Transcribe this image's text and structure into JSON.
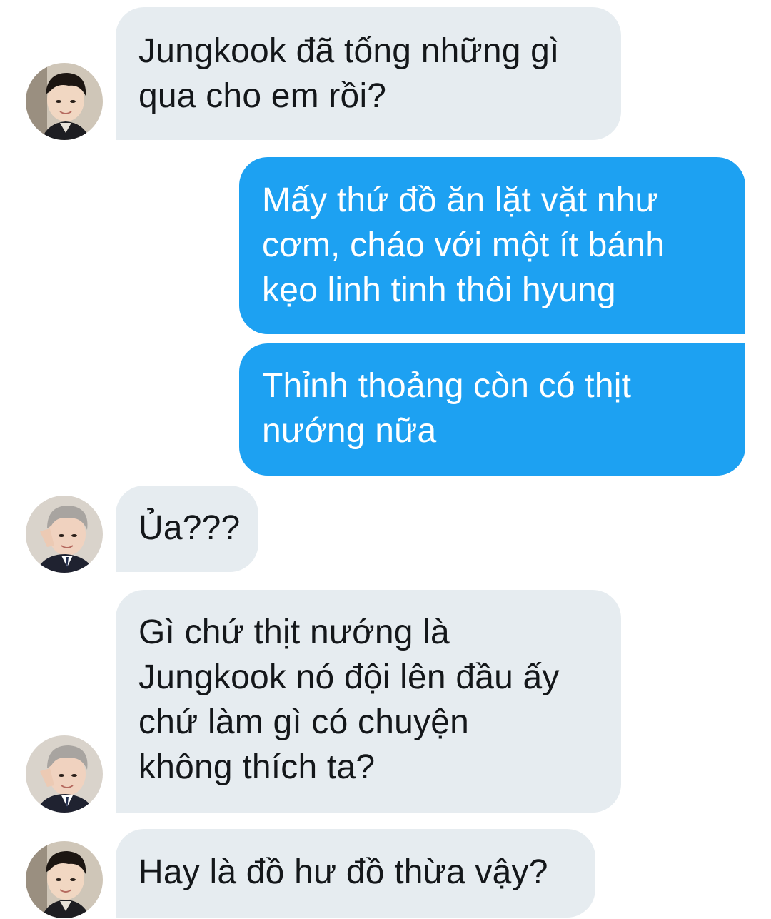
{
  "conversation": {
    "messages": [
      {
        "sender": "received",
        "avatar": "avatar-black-hair",
        "lines": [
          "Jungkook đã tống những gì",
          "qua cho em rồi?"
        ]
      },
      {
        "sender": "sent",
        "lines": [
          "Mấy thứ đồ ăn lặt vặt như",
          "cơm, cháo với một ít bánh",
          "kẹo linh tinh thôi hyung"
        ]
      },
      {
        "sender": "sent",
        "lines": [
          "Thỉnh thoảng còn có thịt",
          "nướng nữa"
        ]
      },
      {
        "sender": "received",
        "avatar": "avatar-gray-hair",
        "lines": [
          "Ủa???"
        ]
      },
      {
        "sender": "received",
        "avatar": "avatar-gray-hair",
        "lines": [
          "Gì chứ thịt nướng là",
          "Jungkook nó đội lên đầu ấy",
          "chứ làm gì có chuyện",
          "không thích ta?"
        ]
      },
      {
        "sender": "received",
        "avatar": "avatar-black-hair",
        "lines": [
          "Hay là đồ hư đồ thừa vậy?"
        ]
      }
    ]
  },
  "colors": {
    "received_bubble": "#e6ecf0",
    "sent_bubble": "#1da1f2",
    "received_text": "#14171a",
    "sent_text": "#ffffff"
  }
}
